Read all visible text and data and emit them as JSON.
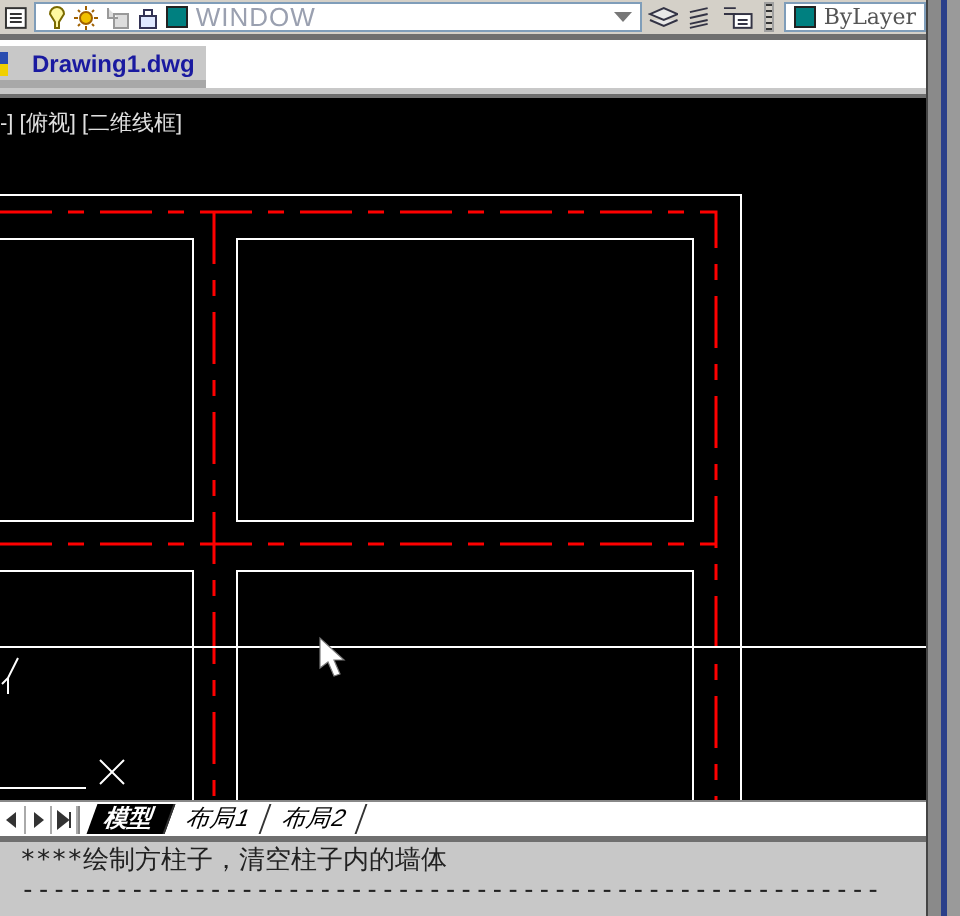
{
  "toolbar": {
    "layer_name": "WINDOW",
    "color_name": "ByLayer"
  },
  "file_tabs": [
    {
      "label": "Drawing1.dwg",
      "selected": true
    }
  ],
  "viewport": {
    "label": "-] [俯视] [二维线框]"
  },
  "layout_tabs": [
    {
      "label": "模型",
      "selected": true
    },
    {
      "label": "布局1",
      "selected": false
    },
    {
      "label": "布局2",
      "selected": false
    }
  ],
  "command_history": [
    "****绘制方柱子，清空柱子内的墙体",
    "-------------------------------------------------------"
  ]
}
